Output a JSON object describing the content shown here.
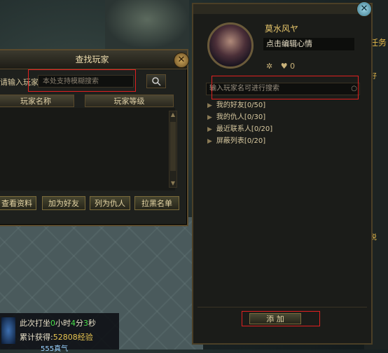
{
  "find_dialog": {
    "title": "查找玩家",
    "label": "请输入玩家名",
    "search_placeholder": "本处支持模糊搜索",
    "col_name": "玩家名称",
    "col_level": "玩家等级",
    "buttons": [
      "查看资料",
      "加为好友",
      "列为仇人",
      "拉黑名单"
    ]
  },
  "friend_panel": {
    "player_name": "莫水风ヤ",
    "mood_text": "点击编辑心情",
    "like_count": "0",
    "search_placeholder": "输入玩家名可进行搜索",
    "groups": [
      "我的好友[0/50]",
      "我的仇人[0/30]",
      "最近联系人[0/20]",
      "屏蔽列表[0/20]"
    ],
    "add_button": "添  加"
  },
  "status": {
    "line1_prefix": "此次打坐",
    "line1_h": "0",
    "line1_m": "4",
    "line1_s": "3",
    "line1_text_h": "小时",
    "line1_text_m": "分",
    "line1_text_s": "秒",
    "line2_prefix": "累计获得:",
    "line2_value": "52808经验",
    "line3": "555真气"
  },
  "right_strip": [
    "任务",
    "好",
    "说"
  ]
}
